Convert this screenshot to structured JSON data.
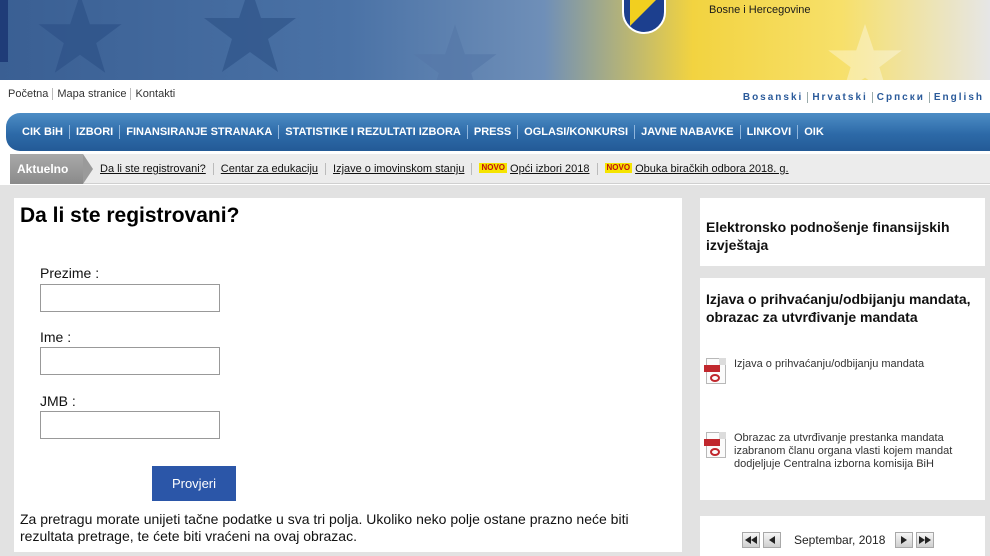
{
  "header": {
    "crest_text": "Bosne i Hercegovine"
  },
  "top_links": [
    "Početna",
    "Mapa stranice",
    "Kontakti"
  ],
  "languages": [
    "Bosanski",
    "Hrvatski",
    "Српски",
    "English"
  ],
  "main_nav": [
    "CIK BiH",
    "IZBORI",
    "FINANSIRANJE STRANAKA",
    "STATISTIKE I REZULTATI IZBORA",
    "PRESS",
    "OGLASI/KONKURSI",
    "JAVNE NABAVKE",
    "LINKOVI",
    "OIK"
  ],
  "aktuelno": {
    "label": "Aktuelno",
    "badge": "NOVO",
    "links": [
      {
        "text": "Da li ste registrovani?",
        "novo": false
      },
      {
        "text": "Centar za edukaciju",
        "novo": false
      },
      {
        "text": "Izjave o imovinskom stanju",
        "novo": false
      },
      {
        "text": "Opći izbori 2018",
        "novo": true
      },
      {
        "text": "Obuka biračkih odbora 2018. g.",
        "novo": true
      }
    ]
  },
  "form": {
    "title": "Da li ste registrovani?",
    "prezime_label": "Prezime :",
    "prezime_value": "",
    "ime_label": "Ime :",
    "ime_value": "",
    "jmb_label": "JMB :",
    "jmb_value": "",
    "submit_label": "Provjeri",
    "help_text": "Za pretragu morate unijeti tačne podatke u sva tri polja. Ukoliko neko polje ostane prazno neće biti rezultata pretrage, te ćete biti vraćeni na ovaj obrazac."
  },
  "sidebar": {
    "box1_title": "Elektronsko podnošenje finansijskih izvještaja",
    "box2_title": "Izjava o prihvaćanju/odbijanju mandata, obrazac za utvrđivanje mandata",
    "documents": [
      "Izjava o prihvaćanju/odbijanju mandata",
      "Obrazac za utvrđivanje prestanka mandata izabranom članu organa vlasti kojem mandat dodjeljuje Centralna izborna komisija BiH"
    ],
    "calendar_month": "Septembar, 2018"
  },
  "colors": {
    "nav_blue": "#2d6aa8",
    "button_blue": "#2b56a8",
    "novo_yellow": "#f5e400",
    "pdf_red": "#c0272d"
  }
}
